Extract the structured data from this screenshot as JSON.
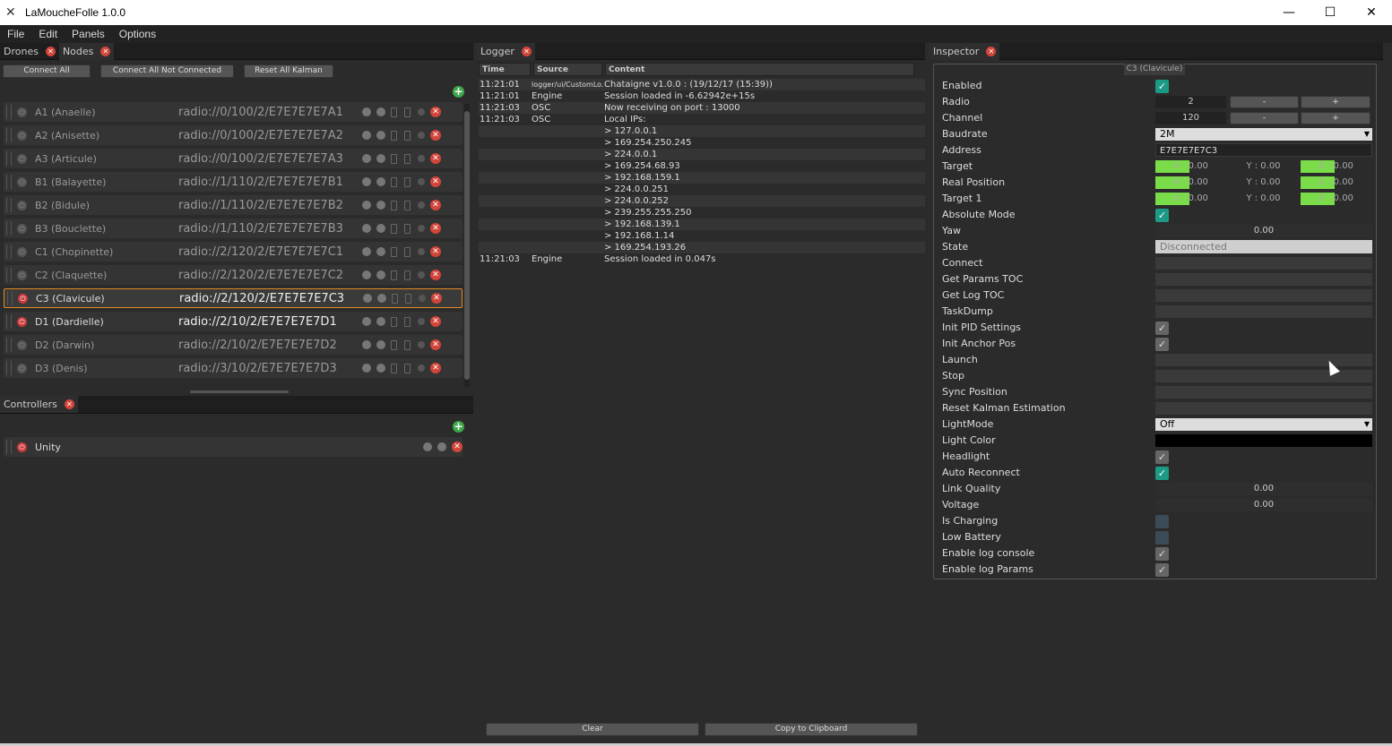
{
  "window": {
    "title": "LaMoucheFolle 1.0.0",
    "minimize": "—",
    "maximize": "☐",
    "close": "✕"
  },
  "menu": [
    "File",
    "Edit",
    "Panels",
    "Options"
  ],
  "left_tabs": {
    "drones": "Drones",
    "nodes": "Nodes"
  },
  "toolbar": {
    "connect_all": "Connect All",
    "connect_not_connected": "Connect All Not Connected",
    "reset_kalman": "Reset All Kalman"
  },
  "nodes": [
    {
      "name": "A1 (Anaelle)",
      "address": "radio://0/100/2/E7E7E7E7A1"
    },
    {
      "name": "A2 (Anisette)",
      "address": "radio://0/100/2/E7E7E7E7A2"
    },
    {
      "name": "A3 (Articule)",
      "address": "radio://0/100/2/E7E7E7E7A3"
    },
    {
      "name": "B1 (Balayette)",
      "address": "radio://1/110/2/E7E7E7E7B1"
    },
    {
      "name": "B2 (Bidule)",
      "address": "radio://1/110/2/E7E7E7E7B2"
    },
    {
      "name": "B3 (Bouclette)",
      "address": "radio://1/110/2/E7E7E7E7B3"
    },
    {
      "name": "C1 (Chopinette)",
      "address": "radio://2/120/2/E7E7E7E7C1"
    },
    {
      "name": "C2 (Claquette)",
      "address": "radio://2/120/2/E7E7E7E7C2"
    },
    {
      "name": "C3 (Clavicule)",
      "address": "radio://2/120/2/E7E7E7E7C3"
    },
    {
      "name": "D1 (Dardielle)",
      "address": "radio://2/10/2/E7E7E7E7D1"
    },
    {
      "name": "D2 (Darwin)",
      "address": "radio://2/10/2/E7E7E7E7D2"
    },
    {
      "name": "D3 (Denis)",
      "address": "radio://3/10/2/E7E7E7E7D3"
    }
  ],
  "controllers": {
    "tab": "Controllers",
    "items": [
      {
        "name": "Unity"
      }
    ]
  },
  "logger": {
    "tab": "Logger",
    "headers": {
      "time": "Time",
      "source": "Source",
      "content": "Content"
    },
    "rows": [
      {
        "time": "11:21:01",
        "source": "logger/ui/CustomLo...",
        "content": "Chataigne v1.0.0 : (19/12/17 (15:39))"
      },
      {
        "time": "11:21:01",
        "source": "Engine",
        "content": "Session loaded in -6.62942e+15s"
      },
      {
        "time": "11:21:03",
        "source": "OSC",
        "content": "Now receiving on port : 13000"
      },
      {
        "time": "11:21:03",
        "source": "OSC",
        "content": "Local IPs:"
      },
      {
        "time": "",
        "source": "",
        "content": " > 127.0.0.1"
      },
      {
        "time": "",
        "source": "",
        "content": " > 169.254.250.245"
      },
      {
        "time": "",
        "source": "",
        "content": " > 224.0.0.1"
      },
      {
        "time": "",
        "source": "",
        "content": " > 169.254.68.93"
      },
      {
        "time": "",
        "source": "",
        "content": " > 192.168.159.1"
      },
      {
        "time": "",
        "source": "",
        "content": " > 224.0.0.251"
      },
      {
        "time": "",
        "source": "",
        "content": " > 224.0.0.252"
      },
      {
        "time": "",
        "source": "",
        "content": " > 239.255.255.250"
      },
      {
        "time": "",
        "source": "",
        "content": " > 192.168.139.1"
      },
      {
        "time": "",
        "source": "",
        "content": " > 192.168.1.14"
      },
      {
        "time": "",
        "source": "",
        "content": " > 169.254.193.26"
      },
      {
        "time": "11:21:03",
        "source": "Engine",
        "content": "Session loaded in 0.047s"
      }
    ],
    "clear": "Clear",
    "copy": "Copy to Clipboard"
  },
  "inspector": {
    "tab": "Inspector",
    "header": "C3 (Clavicule)",
    "labels": {
      "enabled": "Enabled",
      "radio": "Radio",
      "channel": "Channel",
      "baudrate": "Baudrate",
      "address": "Address",
      "target": "Target",
      "real_position": "Real Position",
      "target1": "Target 1",
      "absolute_mode": "Absolute Mode",
      "yaw": "Yaw",
      "state": "State",
      "connect": "Connect",
      "get_params_toc": "Get Params TOC",
      "get_log_toc": "Get Log TOC",
      "taskdump": "TaskDump",
      "init_pid": "Init PID Settings",
      "init_anchor": "Init Anchor Pos",
      "launch": "Launch",
      "stop": "Stop",
      "sync_position": "Sync Position",
      "reset_kalman": "Reset Kalman Estimation",
      "lightmode": "LightMode",
      "light_color": "Light Color",
      "headlight": "Headlight",
      "auto_reconnect": "Auto Reconnect",
      "link_quality": "Link Quality",
      "voltage": "Voltage",
      "is_charging": "Is Charging",
      "low_battery": "Low Battery",
      "enable_log_console": "Enable log console",
      "enable_log_params": "Enable log Params"
    },
    "values": {
      "radio": "2",
      "channel": "120",
      "baudrate": "2M",
      "address": "E7E7E7E7C3",
      "x": "X : 0.00",
      "y": "Y : 0.00",
      "z": "Z : 0.00",
      "yaw": "0.00",
      "state": "Disconnected",
      "lightmode": "Off",
      "link_quality": "0.00",
      "voltage": "0.00",
      "minus": "-",
      "plus": "+",
      "check": "✓"
    },
    "light_color": "#000000"
  },
  "colors": {
    "accent": "#e58a1f",
    "close": "#d2453a",
    "add": "#3fa84a",
    "teal": "#1c9a86",
    "xyz_fill": "#7bdc4a"
  }
}
